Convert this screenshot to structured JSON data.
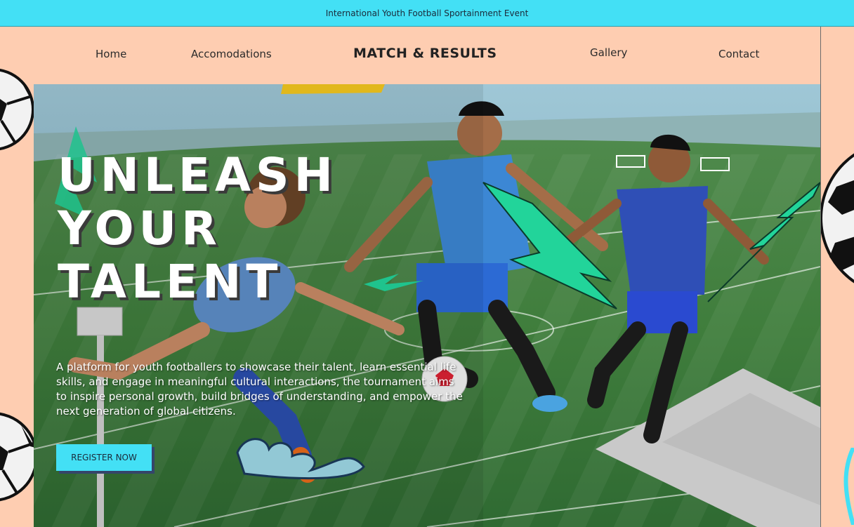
{
  "announcement": {
    "text": "International Youth Football Sportainment Event"
  },
  "nav": {
    "items": [
      {
        "label": "Home"
      },
      {
        "label": "Accomodations"
      },
      {
        "label": "MATCH & RESULTS"
      },
      {
        "label": "Gallery"
      },
      {
        "label": "Contact"
      }
    ]
  },
  "hero": {
    "headline": [
      "UNLEASH",
      "YOUR",
      "TALENT"
    ],
    "description": "A platform for youth footballers to showcase their talent, learn essential life skills, and engage in meaningful cultural interactions, the tournament aims to inspire personal growth, build bridges of understanding, and empower the next generation of global citizens.",
    "cta_label": "REGISTER NOW"
  },
  "colors": {
    "announcement_bg": "#43e0f5",
    "page_bg": "#fecdb1",
    "cta_bg": "#43e0f5",
    "cta_shadow": "#35456a",
    "accent_green": "#22d49a"
  }
}
